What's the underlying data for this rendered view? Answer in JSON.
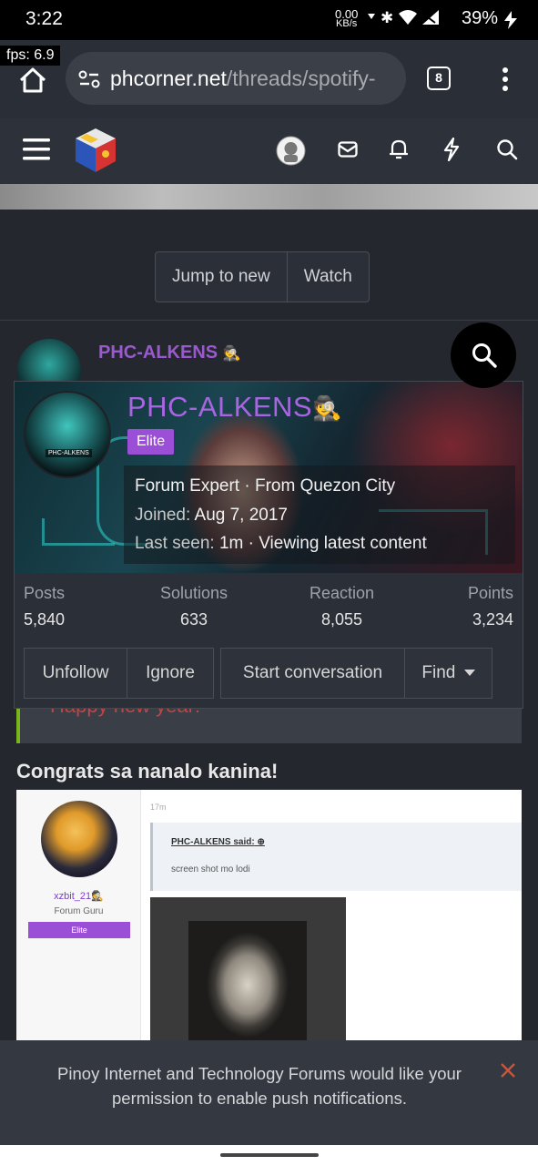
{
  "status_bar": {
    "time": "3:22",
    "net_speed": "0.00",
    "net_unit": "KB/s",
    "battery": "39%"
  },
  "fps_overlay": "fps: 6.9",
  "browser": {
    "url_host": "phcorner.net",
    "url_path": "/threads/spotify-",
    "tab_count": "8"
  },
  "thread_actions": {
    "jump_label": "Jump to new",
    "watch_label": "Watch"
  },
  "post": {
    "author": "PHC-ALKENS"
  },
  "member_card": {
    "name": "PHC-ALKENS",
    "badge": "Elite",
    "avatar_tag": "PHC-ALKENS",
    "title_line": "Forum Expert · From Quezon City",
    "joined_label": "Joined:",
    "joined_value": "Aug 7, 2017",
    "last_seen_label": "Last seen:",
    "last_seen_value": "1m · Viewing latest content",
    "stats": [
      {
        "label": "Posts",
        "value": "5,840"
      },
      {
        "label": "Solutions",
        "value": "633"
      },
      {
        "label": "Reaction",
        "value": "8,055"
      },
      {
        "label": "Points",
        "value": "3,234"
      }
    ],
    "buttons": {
      "unfollow": "Unfollow",
      "ignore": "Ignore",
      "start_conversation": "Start conversation",
      "find": "Find"
    }
  },
  "post_body": {
    "partial_red_text": "Happy new year!",
    "heading": "Congrats sa nanalo kanina!"
  },
  "embedded_screenshot": {
    "username": "xzbit_21",
    "role": "Forum Guru",
    "badge": "Elite",
    "time": "17m",
    "quote_author": "PHC-ALKENS said:",
    "quote_text": "screen shot mo lodi"
  },
  "push_prompt": {
    "text": "Pinoy Internet and Technology Forums would like your permission to enable push notifications."
  },
  "colors": {
    "accent_purple": "#9b4fd6",
    "username_purple": "#a766e0",
    "close_red": "#c9553d"
  }
}
